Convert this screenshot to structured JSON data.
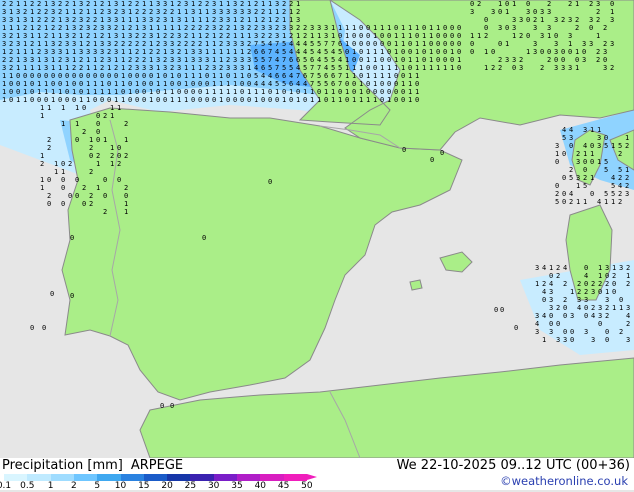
{
  "map": {
    "colors": {
      "sea": "#e6e6e6",
      "land": "#aaee88",
      "coast": "#8a8a8a",
      "border": "#a7a7a7",
      "precip_light": "#c8ecff",
      "precip_mid": "#8fd3ff",
      "precip_strong": "#5cb3ff"
    },
    "grid_numbers_color": "#000000",
    "values_sample": [
      "0",
      "1",
      "2",
      "3",
      "4",
      "5",
      "6",
      "7",
      "8",
      "10",
      "12",
      "15"
    ]
  },
  "footer": {
    "title": "Precipitation [mm]",
    "model": "ARPEGE",
    "datetime": "We 22-10-2025 09..12 UTC (00+36)",
    "credit": "©weatheronline.co.uk",
    "colorbar": {
      "ticks": [
        "0.1",
        "0.5",
        "1",
        "2",
        "5",
        "10",
        "15",
        "20",
        "25",
        "30",
        "35",
        "40",
        "45",
        "50"
      ],
      "colors": [
        "#d9f5ff",
        "#bfeaff",
        "#9fdcff",
        "#6fc6ff",
        "#3fa8f0",
        "#2a82e0",
        "#1a5bc8",
        "#1636a8",
        "#3a22b0",
        "#7a1ec8",
        "#b01ec8",
        "#d81ec0",
        "#f01ebc"
      ]
    }
  }
}
